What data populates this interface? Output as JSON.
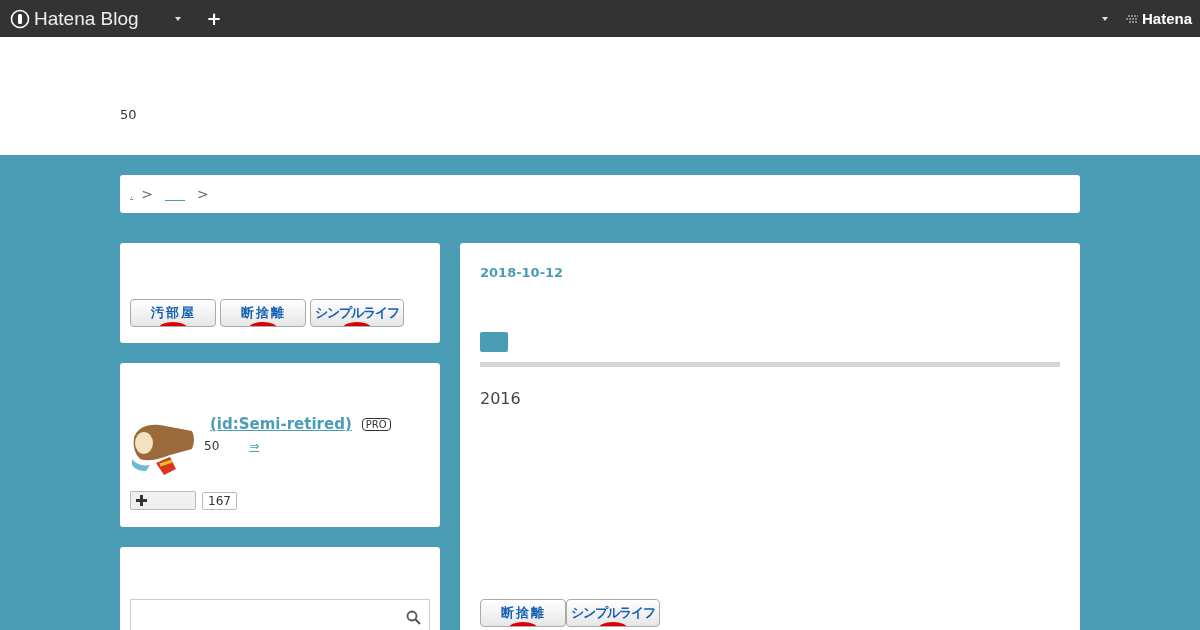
{
  "topbar": {
    "brand": "Hatena Blog",
    "plus": "+",
    "hatena": "Hatena"
  },
  "header": {
    "subtitle": "50"
  },
  "breadcrumb": {
    "items": [
      {
        "kind": "link",
        "text": "."
      },
      {
        "kind": "sep",
        "text": ">"
      },
      {
        "kind": "blank"
      },
      {
        "kind": "sep",
        "text": ">"
      }
    ]
  },
  "sidebar": {
    "banners": [
      "汚部屋",
      "断捨離",
      "シンプルライフ"
    ],
    "profile": {
      "name": "(id:Semi-retired)",
      "badge": "PRO",
      "age": "50",
      "more": "⇒",
      "follow_count": "167"
    }
  },
  "article": {
    "date": "2018-10-12",
    "body": "2016",
    "banners": [
      "断捨離",
      "シンプルライフ"
    ]
  }
}
